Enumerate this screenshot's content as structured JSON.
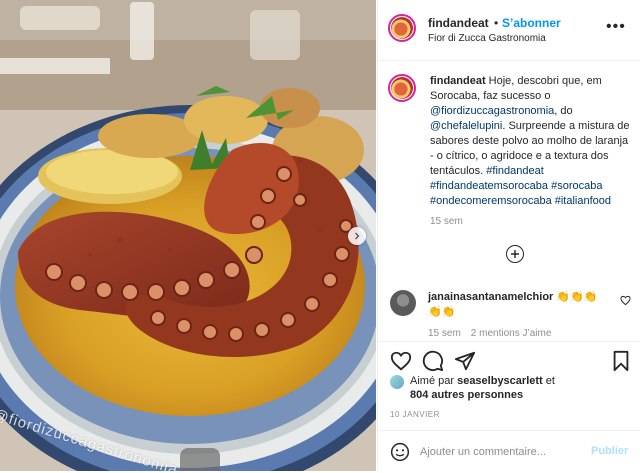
{
  "post": {
    "photo": {
      "watermark": "@fiordizuccagastronomia",
      "description_icon": "instagram-glyph-icon"
    },
    "header": {
      "username": "findandeat",
      "separator": "•",
      "follow_label": "S’abonner",
      "location": "Fior di Zucca Gastronomia",
      "more_label": "•••"
    },
    "caption": {
      "username": "findandeat",
      "text_1": " Hoje, descobri que, em Sorocaba, faz sucesso o ",
      "mention_1": "@fiordizuccagastronomia",
      "text_2": ", do ",
      "mention_2": "@chefalelupini",
      "text_3": ". Surpreende a mistura de sabores deste polvo ao molho de laranja - o cítrico, o agridoce e a textura dos tentáculos. ",
      "hashtags": [
        "#findandeat",
        "#findandeatemsorocaba",
        "#sorocaba",
        "#ondecomeremsorocaba",
        "#italianfood"
      ],
      "time": "15 sem"
    },
    "comment": {
      "username": "janainasantanamelchior",
      "text": " 👏👏👏👏👏",
      "time": "15 sem",
      "mentions": "2 mentions J’aime"
    },
    "actions": {
      "liked_prefix": "Aimé par ",
      "liked_by": "seaselbyscarlett",
      "liked_and": " et",
      "others": "804 autres personnes",
      "date": "10 JANVIER"
    },
    "comment_box": {
      "placeholder": "Ajouter un commentaire...",
      "publish_label": "Publier"
    }
  },
  "colors": {
    "accent": "#0095f6",
    "link": "#00376b",
    "muted": "#8e8e8e",
    "publish_disabled": "#b2dffc",
    "border": "#efefef"
  }
}
